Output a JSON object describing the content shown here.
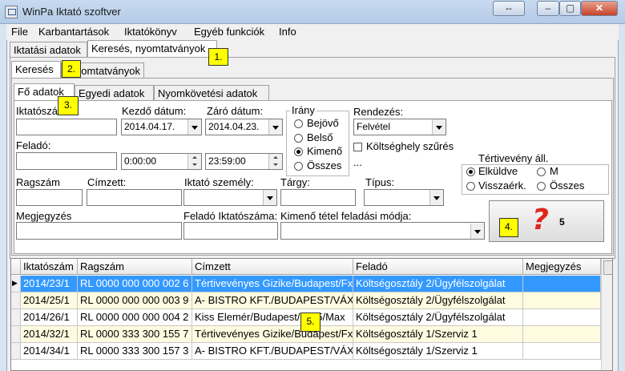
{
  "window": {
    "title": "WinPa Iktató szoftver"
  },
  "menu": [
    "File",
    "Karbantartások",
    "Iktatókönyv",
    "Egyéb funkciók",
    "Info"
  ],
  "top_tabs": [
    "Iktatási adatok",
    "Keresés, nyomtatványok"
  ],
  "sub_tabs": [
    "Keresés",
    "Nyomtatványok"
  ],
  "inner_tabs": [
    "Fő adatok",
    "Egyedi adatok",
    "Nyomkövetési adatok"
  ],
  "callouts": [
    "1.",
    "2.",
    "3.",
    "4.",
    "5."
  ],
  "form": {
    "iktatoszam_label": "Iktatószám",
    "kezdo_label": "Kezdő dátum:",
    "kezdo_value": "2014.04.17.",
    "zaro_label": "Záró dátum:",
    "zaro_value": "2014.04.23.",
    "kezdo_time": "0:00:00",
    "zaro_time": "23:59:00",
    "felado_label": "Feladó:",
    "irany_label": "Irány",
    "irany_options": [
      "Bejövő",
      "Belső",
      "Kimenő",
      "Összes"
    ],
    "irany_selected": "Kimenő",
    "rendezes_label": "Rendezés:",
    "rendezes_value": "Felvétel",
    "koltseg_label": "Költséghely szűrés",
    "ellipsis": "...",
    "tertiveveny_label": "Tértivevény áll.",
    "tertiveveny_options": [
      "Elküldve",
      "M",
      "Visszaérk.",
      "Összes"
    ],
    "tertiveveny_selected": "Elküldve",
    "ragszam_label": "Ragszám",
    "cimzett_label": "Címzett:",
    "iktato_szemely_label": "Iktató személy:",
    "targy_label": "Tárgy:",
    "tipus_label": "Típus:",
    "megjegyzes_label": "Megjegyzés",
    "felado_iktatoszama_label": "Feladó Iktatószáma:",
    "kimeno_mod_label": "Kimenő tétel feladási módja:",
    "search_icon_glyph": "?",
    "search_count": "5"
  },
  "grid": {
    "headers": [
      "Iktatószám",
      "Ragszám",
      "Címzett",
      "Feladó",
      "Megjegyzés"
    ],
    "rows": [
      [
        "2014/23/1",
        "RL 0000 000 000 002 6",
        "Tértivevényes Gizike/Budapest/Fx/",
        "Költségosztály 2/Ügyfélszolgálat",
        ""
      ],
      [
        "2014/25/1",
        "RL 0000 000 000 003 9",
        "A- BISTRO KFT./BUDAPEST/VÁX",
        "Költségosztály 2/Ügyfélszolgálat",
        ""
      ],
      [
        "2014/26/1",
        "RL 0000 000 000 004 2",
        "Kiss Elemér/Budapest/1125/Max",
        "Költségosztály 2/Ügyfélszolgálat",
        ""
      ],
      [
        "2014/32/1",
        "RL 0000 333 300 155 7",
        "Tértivevényes Gizike/Budapest/Fx/",
        "Költségosztály 1/Szerviz 1",
        ""
      ],
      [
        "2014/34/1",
        "RL 0000 333 300 157 3",
        "A- BISTRO KFT./BUDAPEST/VÁX",
        "Költségosztály 1/Szerviz 1",
        ""
      ]
    ]
  },
  "colors": {
    "selected_row": "#3399ff",
    "alt_row": "#fffbe0",
    "callout": "#ffff00",
    "question_mark": "#e0261b"
  }
}
